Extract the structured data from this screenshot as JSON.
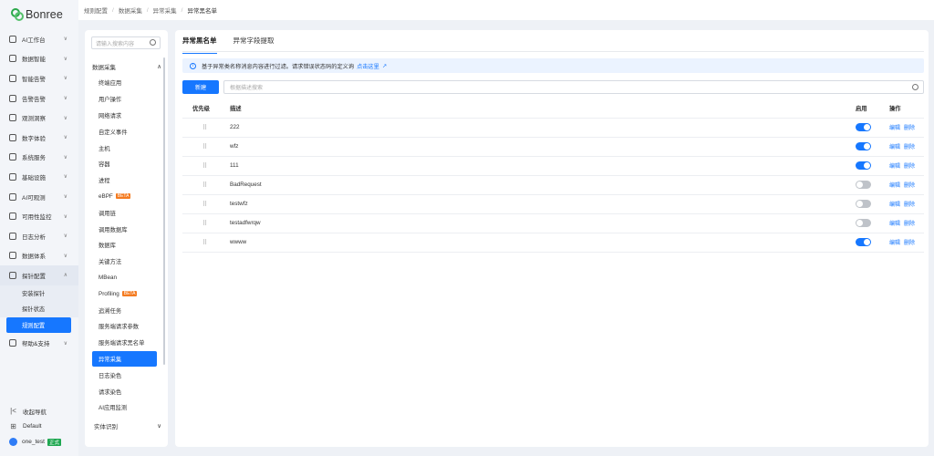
{
  "nav": {
    "logo": "Bonree",
    "items": [
      {
        "icon": "ai-workbench-icon",
        "label": "AI工作台",
        "open": false
      },
      {
        "icon": "data-intelligence-icon",
        "label": "数据智能",
        "open": false
      },
      {
        "icon": "intelligent-alert-icon",
        "label": "智能告警",
        "open": false
      },
      {
        "icon": "alarm-response-icon",
        "label": "告警告警",
        "open": false
      },
      {
        "icon": "observability-insight-icon",
        "label": "观测洞察",
        "open": false
      },
      {
        "icon": "digital-experience-icon",
        "label": "数字体验",
        "open": false
      },
      {
        "icon": "system-service-icon",
        "label": "系统服务",
        "open": false
      },
      {
        "icon": "infrastructure-icon",
        "label": "基础设施",
        "open": false
      },
      {
        "icon": "ai-observability-icon",
        "label": "AI可观测",
        "open": false
      },
      {
        "icon": "availability-monitor-icon",
        "label": "可用性监控",
        "open": false
      },
      {
        "icon": "log-analysis-icon",
        "label": "日志分析",
        "open": false
      },
      {
        "icon": "data-system-icon",
        "label": "数据体系",
        "open": false
      },
      {
        "icon": "probe-config-icon",
        "label": "探针配置",
        "open": true
      }
    ],
    "sub_items": [
      {
        "label": "安装探针",
        "active": false
      },
      {
        "label": "探针状态",
        "active": false
      },
      {
        "label": "规则配置",
        "active": true
      }
    ],
    "help": {
      "icon": "help-support-icon",
      "label": "帮助&支持"
    },
    "bottom": [
      {
        "icon": "collapse-nav-icon",
        "label": "收起导航"
      },
      {
        "icon": "workspace-icon",
        "label": "Default"
      }
    ],
    "user": {
      "name": "one_test",
      "badge": "正式"
    }
  },
  "breadcrumb": [
    "规则配置",
    "数据采集",
    "异常采集",
    "异常黑名单"
  ],
  "panel2": {
    "search_placeholder": "请输入搜索内容",
    "group_label": "数据采集",
    "items": [
      {
        "label": "终端应用",
        "beta": ""
      },
      {
        "label": "用户操作",
        "beta": ""
      },
      {
        "label": "网络请求",
        "beta": ""
      },
      {
        "label": "自定义事件",
        "beta": ""
      },
      {
        "label": "主机",
        "beta": ""
      },
      {
        "label": "容器",
        "beta": ""
      },
      {
        "label": "进程",
        "beta": ""
      },
      {
        "label": "eBPF",
        "beta": "BETA"
      },
      {
        "label": "调用链",
        "beta": ""
      },
      {
        "label": "调用数据库",
        "beta": ""
      },
      {
        "label": "数据库",
        "beta": ""
      },
      {
        "label": "关键方法",
        "beta": ""
      },
      {
        "label": "MBean",
        "beta": ""
      },
      {
        "label": "Profiling",
        "beta": "BETA"
      },
      {
        "label": "追溯任务",
        "beta": ""
      },
      {
        "label": "服务端请求参数",
        "beta": ""
      },
      {
        "label": "服务端请求黑名单",
        "beta": ""
      },
      {
        "label": "异常采集",
        "beta": ""
      },
      {
        "label": "日志染色",
        "beta": ""
      },
      {
        "label": "请求染色",
        "beta": ""
      },
      {
        "label": "AI应用监测",
        "beta": ""
      }
    ],
    "active_index": 17,
    "group2_label": "实体识别"
  },
  "main": {
    "tabs": [
      "异常黑名单",
      "异常字段提取"
    ],
    "info_text": "基于异常类名称消息内容进行过滤。请求错误状态码的定义询",
    "info_link": "点击这里",
    "new_button": "新建",
    "search_placeholder": "根据描述搜索",
    "columns": {
      "priority": "优先级",
      "desc": "描述",
      "enabled": "启用",
      "ops": "操作"
    },
    "edit_label": "编辑",
    "delete_label": "删除",
    "rows": [
      {
        "desc": "222",
        "enabled": true
      },
      {
        "desc": "wfz",
        "enabled": true
      },
      {
        "desc": "111",
        "enabled": true
      },
      {
        "desc": "BadRequest",
        "enabled": false
      },
      {
        "desc": "testwfz",
        "enabled": false
      },
      {
        "desc": "testadfwrqw",
        "enabled": false
      },
      {
        "desc": "wwww",
        "enabled": true
      }
    ]
  }
}
